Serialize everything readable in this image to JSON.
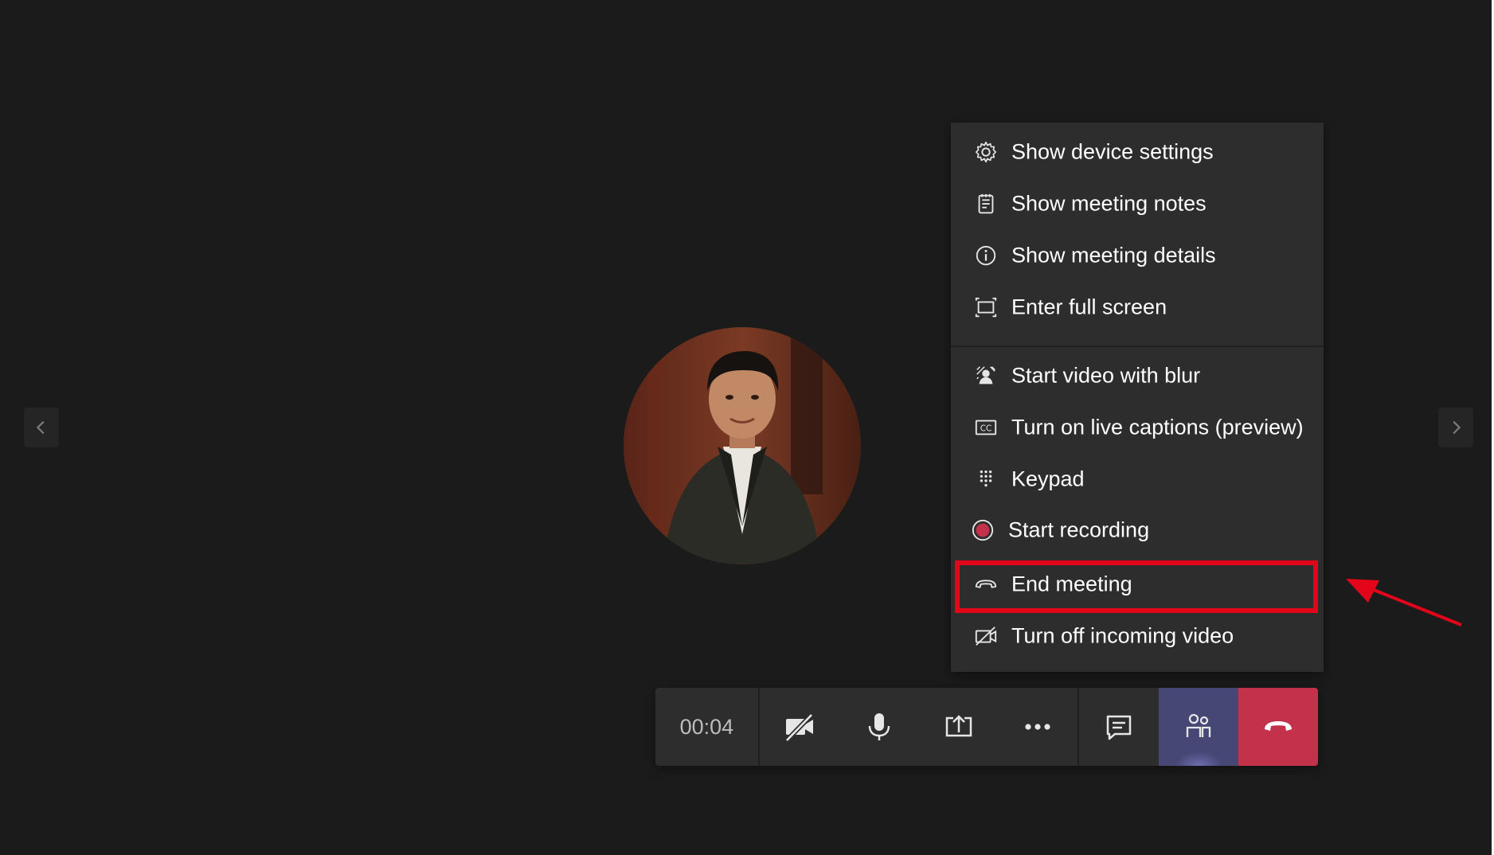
{
  "toolbar": {
    "timer": "00:04",
    "buttons": [
      {
        "name": "camera-off-button",
        "icon": "video-off-icon"
      },
      {
        "name": "mic-button",
        "icon": "microphone-icon"
      },
      {
        "name": "share-button",
        "icon": "share-screen-icon"
      },
      {
        "name": "more-actions-button",
        "icon": "more-horizontal-icon"
      },
      {
        "name": "chat-button",
        "icon": "chat-icon"
      },
      {
        "name": "participants-button",
        "icon": "people-icon"
      },
      {
        "name": "hang-up-button",
        "icon": "phone-hangup-icon"
      }
    ]
  },
  "menu": {
    "items": [
      {
        "label": "Show device settings",
        "icon": "gear-icon"
      },
      {
        "label": "Show meeting notes",
        "icon": "notes-icon"
      },
      {
        "label": "Show meeting details",
        "icon": "info-icon"
      },
      {
        "label": "Enter full screen",
        "icon": "fullscreen-icon"
      },
      {
        "label": "Start video with blur",
        "icon": "blur-background-icon"
      },
      {
        "label": "Turn on live captions (preview)",
        "icon": "cc-icon"
      },
      {
        "label": "Keypad",
        "icon": "keypad-icon"
      },
      {
        "label": "Start recording",
        "icon": "record-icon"
      },
      {
        "label": "End meeting",
        "icon": "end-call-icon"
      },
      {
        "label": "Turn off incoming video",
        "icon": "incoming-video-off-icon"
      }
    ],
    "highlighted_item": "End meeting"
  },
  "colors": {
    "background": "#1b1b1b",
    "panel": "#2d2d2d",
    "accent": "#464775",
    "hangup": "#c4314b",
    "record": "#c4314b",
    "annotation": "#e3061b"
  }
}
